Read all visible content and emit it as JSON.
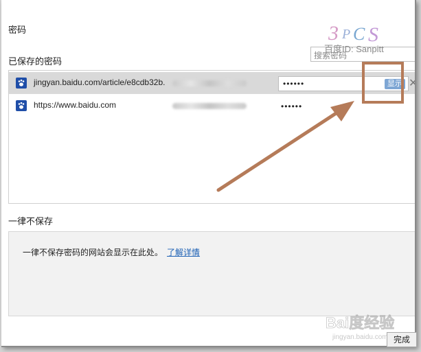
{
  "dialog": {
    "title": "密码",
    "saved_section_title": "已保存的密码",
    "search_placeholder": "搜索密码",
    "passwords": [
      {
        "site": "jingyan.baidu.com/article/e8cdb32b.",
        "password_mask": "••••••",
        "selected": true
      },
      {
        "site": "https://www.baidu.com",
        "password_mask": "••••••",
        "selected": false
      }
    ],
    "show_button_label": "显示",
    "remove_label": "✕",
    "never_section_title": "一律不保存",
    "never_text": "一律不保存密码的网站会显示在此处。",
    "learn_more": "了解详情",
    "done_label": "完成"
  },
  "overlay": {
    "watermark_text": "百度ID: Sanpitt",
    "baidu_watermark": "Bai度经验",
    "baidu_url": "jingyan.baidu.com",
    "annotation_color": "#b57b59"
  }
}
